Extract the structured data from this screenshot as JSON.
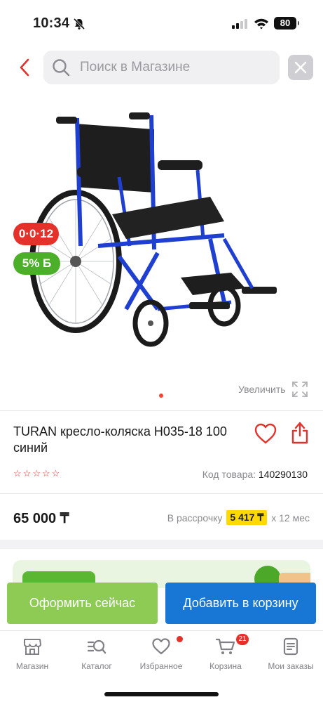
{
  "status_bar": {
    "time": "10:34",
    "battery": "80"
  },
  "search": {
    "placeholder": "Поиск в Магазине"
  },
  "product": {
    "badges": {
      "installment": "0·0·12",
      "bonus": "5% Б"
    },
    "zoom_label": "Увеличить",
    "title": "TURAN кресло-коляска Н035-18 100 синий",
    "rating_stars": 5,
    "sku_label": "Код товара:",
    "sku_value": "140290130",
    "price": "65 000 ₸",
    "installment_prefix": "В рассрочку",
    "installment_amount": "5 417 ₸",
    "installment_suffix": "х 12 мес"
  },
  "actions": {
    "checkout_label": "Оформить сейчас",
    "cart_label": "Добавить в корзину"
  },
  "tabbar": {
    "items": [
      {
        "label": "Магазин",
        "icon": "shop-icon"
      },
      {
        "label": "Каталог",
        "icon": "catalog-search-icon"
      },
      {
        "label": "Избранное",
        "icon": "heart-icon"
      },
      {
        "label": "Корзина",
        "icon": "cart-icon"
      },
      {
        "label": "Мои заказы",
        "icon": "orders-icon"
      }
    ],
    "cart_count": "21"
  },
  "colors": {
    "accent_red": "#e4322b",
    "checkout_green": "#8ecb54",
    "cart_blue": "#1877d4",
    "installment_yellow": "#ffd900"
  }
}
